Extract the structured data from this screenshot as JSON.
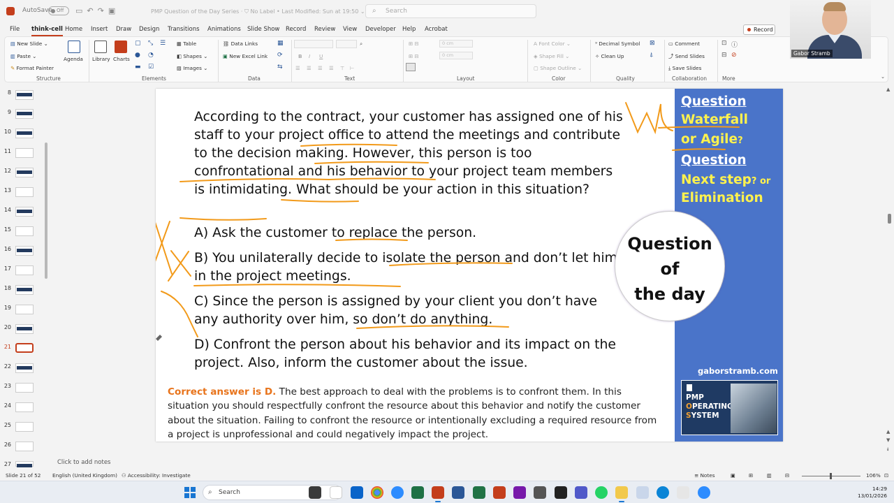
{
  "titlebar": {
    "autosave_label": "AutoSave",
    "autosave_state": "Off",
    "document_title": "PMP Question of the Day Series",
    "label_status": "No Label",
    "last_modified": "Last Modified: Sun at 19:50",
    "search_placeholder": "Search"
  },
  "ribbon_tabs": [
    "File",
    "think-cell",
    "Home",
    "Insert",
    "Draw",
    "Design",
    "Transitions",
    "Animations",
    "Slide Show",
    "Record",
    "Review",
    "View",
    "Developer",
    "Help",
    "Acrobat"
  ],
  "active_tab": "think-cell",
  "record_button": "Record",
  "ribbon": {
    "structure": {
      "new_slide": "New Slide",
      "paste": "Paste",
      "format_painter": "Format Painter",
      "agenda": "Agenda",
      "label": "Structure"
    },
    "elements": {
      "library": "Library",
      "charts": "Charts",
      "table": "Table",
      "shapes": "Shapes",
      "images": "Images",
      "label": "Elements"
    },
    "data": {
      "data_links": "Data Links",
      "new_excel_link": "New Excel Link",
      "label": "Data"
    },
    "text": {
      "label": "Text",
      "bold": "B",
      "italic": "I",
      "underline": "U"
    },
    "layout": {
      "label": "Layout",
      "size1": "0 cm",
      "size2": "0 cm"
    },
    "color": {
      "font_color": "Font Color",
      "shape_fill": "Shape Fill",
      "shape_outline": "Shape Outline",
      "label": "Color"
    },
    "quality": {
      "decimal_symbol": "Decimal Symbol",
      "clean_up": "Clean Up",
      "label": "Quality"
    },
    "collaboration": {
      "comment": "Comment",
      "send_slides": "Send Slides",
      "save_slides": "Save Slides",
      "label": "Collaboration"
    },
    "more": {
      "label": "More"
    }
  },
  "webcam": {
    "name": "Gabor Stramb"
  },
  "thumbnails": {
    "numbers": [
      "8",
      "9",
      "10",
      "11",
      "12",
      "13",
      "14",
      "15",
      "16",
      "17",
      "18",
      "19",
      "20",
      "21",
      "22",
      "23",
      "24",
      "25",
      "26",
      "27"
    ],
    "active": "21"
  },
  "slide": {
    "question": "According to the contract, your customer has assigned one of his staff to your project office to attend the meetings and contribute to the decision making. However, this person is too confrontational and his behavior to your project team members is intimidating. What should be your action in this situation?",
    "option_a": "A) Ask the customer to replace the person.",
    "option_b": "B) You unilaterally decide to isolate the person and don’t let him in the project meetings.",
    "option_c": "C) Since the person is assigned by your client you don’t have any authority over him, so don’t do anything.",
    "option_d": "D) Confront the person about his behavior and its impact on the project. Also, inform the customer about the issue.",
    "correct_answer": "Correct answer is D.",
    "explanation": " The best approach to deal with the problems is to confront them. In this situation you should respectfully confront the resource about this behavior and notify the customer about the situation. Failing to confront the resource or intentionally excluding a required resource from a project is unprofessional and could negatively impact the project.",
    "side_panel": {
      "line1": "Question",
      "line2": "Waterfall",
      "line3": "or Agile",
      "line3_suffix": "?",
      "line4": "Question",
      "line5": "Next step",
      "line5_suffix": "? or",
      "line6": "Elimination",
      "website": "gaborstramb.com",
      "card_title_1": "PMP",
      "card_title_2a": "O",
      "card_title_2b": "PERATING",
      "card_title_3a": "S",
      "card_title_3b": "YSTEM"
    },
    "circle": {
      "line1": "Question",
      "line2": "of",
      "line3": "the day"
    },
    "colors": {
      "panel_blue": "#4a74c9",
      "highlight_yellow": "#fff24d",
      "answer_orange": "#e8741c",
      "annotation_orange": "#f29a1a"
    }
  },
  "notes_placeholder": "Click to add notes",
  "statusbar": {
    "slide_info": "Slide 21 of 52",
    "language": "English (United Kingdom)",
    "accessibility": "Accessibility: Investigate",
    "notes": "Notes",
    "zoom": "106%"
  },
  "taskbar": {
    "search": "Search",
    "time": "14:29",
    "date": "13/01/2026"
  }
}
